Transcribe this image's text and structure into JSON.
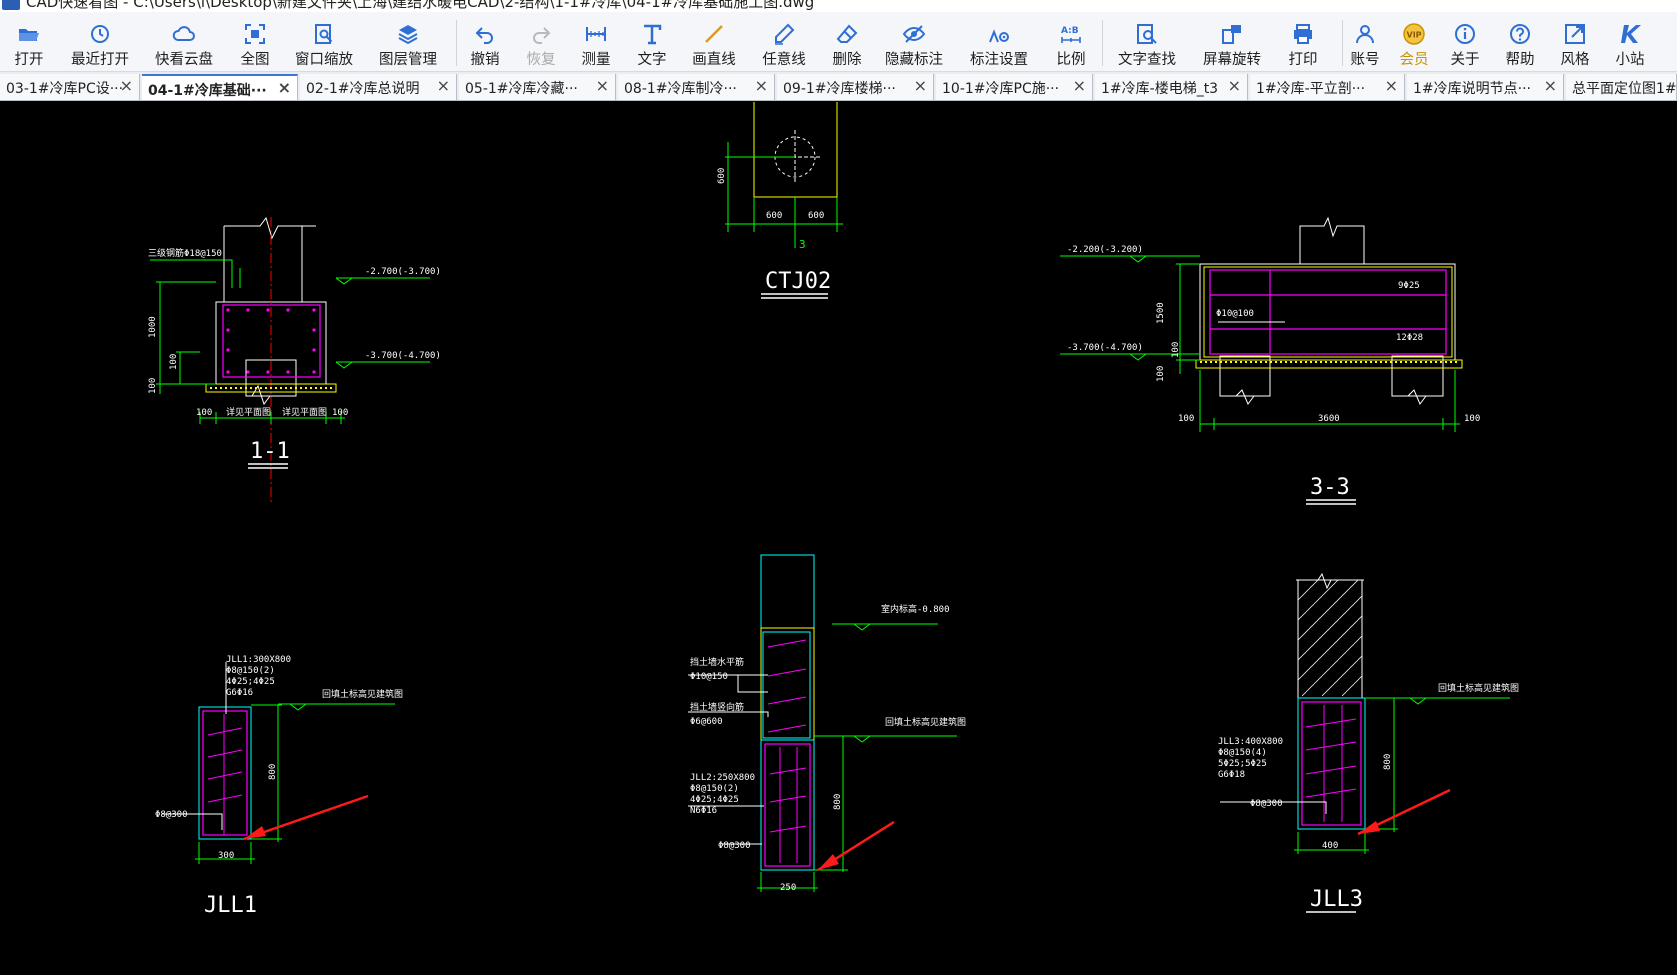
{
  "window": {
    "title": "CAD快速看图 - C:\\Users\\l\\Desktop\\新建文件夹\\上海\\建结水暖电CAD\\2-结构\\1-1#冷库\\04-1#冷库基础施工图.dwg"
  },
  "toolbar": {
    "items": [
      {
        "label": "打开",
        "icon": "folder-open-icon"
      },
      {
        "label": "最近打开",
        "icon": "history-clock-icon"
      },
      {
        "label": "快看云盘",
        "icon": "cloud-icon"
      },
      {
        "label": "全图",
        "icon": "fit-all-icon"
      },
      {
        "label": "窗口缩放",
        "icon": "window-zoom-icon"
      },
      {
        "label": "图层管理",
        "icon": "layers-icon"
      },
      {
        "label": "撤销",
        "icon": "undo-icon"
      },
      {
        "label": "恢复",
        "icon": "redo-icon"
      },
      {
        "label": "测量",
        "icon": "measure-ruler-icon"
      },
      {
        "label": "文字",
        "icon": "text-t-icon"
      },
      {
        "label": "画直线",
        "icon": "line-icon"
      },
      {
        "label": "任意线",
        "icon": "pen-icon"
      },
      {
        "label": "删除",
        "icon": "eraser-icon"
      },
      {
        "label": "隐藏标注",
        "icon": "eye-hide-icon"
      },
      {
        "label": "标注设置",
        "icon": "annotation-settings-icon"
      },
      {
        "label": "比例",
        "icon": "scale-ab-icon"
      },
      {
        "label": "文字查找",
        "icon": "text-search-icon"
      },
      {
        "label": "屏幕旋转",
        "icon": "screen-rotate-icon"
      },
      {
        "label": "打印",
        "icon": "printer-icon"
      },
      {
        "label": "账号",
        "icon": "user-icon"
      },
      {
        "label": "会员",
        "icon": "vip-badge-icon"
      },
      {
        "label": "关于",
        "icon": "info-icon"
      },
      {
        "label": "帮助",
        "icon": "help-icon"
      },
      {
        "label": "风格",
        "icon": "style-icon"
      },
      {
        "label": "小站",
        "icon": "site-k-icon"
      }
    ]
  },
  "tabs": [
    {
      "label": "03-1#冷库PC设···",
      "active": false
    },
    {
      "label": "04-1#冷库基础···",
      "active": true
    },
    {
      "label": "02-1#冷库总说明",
      "active": false
    },
    {
      "label": "05-1#冷库冷藏···",
      "active": false
    },
    {
      "label": "08-1#冷库制冷···",
      "active": false
    },
    {
      "label": "09-1#冷库楼梯···",
      "active": false
    },
    {
      "label": "10-1#冷库PC施···",
      "active": false
    },
    {
      "label": "1#冷库-楼电梯_t3",
      "active": false
    },
    {
      "label": "1#冷库-平立剖···",
      "active": false
    },
    {
      "label": "1#冷库说明节点···",
      "active": false
    },
    {
      "label": "总平面定位图1#",
      "active": false
    }
  ],
  "tab_close": "×",
  "drawing": {
    "titles": {
      "s11": "1-1",
      "ctj02": "CTJ02",
      "s33": "3-3",
      "jll1": "JLL1",
      "jll3": "JLL3"
    },
    "s11": {
      "note": "三级钢筋Φ18@150",
      "elev_top": "-2.700(-3.700)",
      "elev_bot": "-3.700(-4.700)",
      "dim_height": "1000",
      "dim_100a": "100",
      "dim_100b": "100",
      "dim_left": "100",
      "dim_w1": "详见平面图",
      "dim_w2": "详见平面图",
      "dim_right": "100"
    },
    "ctj02": {
      "dim_600v": "600",
      "dim_600a": "600",
      "dim_600b": "600",
      "marker": "3"
    },
    "s33": {
      "elev_top": "-2.200(-3.200)",
      "elev_bot": "-3.700(-4.700)",
      "dim_h": "1500",
      "dim_100v": "100",
      "dim_100": "100",
      "rebar_top": "9Φ25",
      "rebar_mid": "Φ10@100",
      "rebar_bot": "12Φ28",
      "dim_left": "100",
      "dim_span": "3600",
      "dim_right": "100"
    },
    "jll1": {
      "spec1": "JLL1:300X800",
      "spec2": "Φ8@150(2)",
      "spec3": "4Φ25;4Φ25",
      "spec4": "G6Φ16",
      "note": "回填土标高见建筑图",
      "dim_h": "800",
      "stirrup": "Φ8@300",
      "width": "300"
    },
    "jll2": {
      "elev": "室内标高-0.800",
      "wall1": "挡土墙水平筋",
      "wall1b": "Φ10@150",
      "wall2": "挡土墙竖向筋",
      "wall2b": "Φ6@600",
      "note": "回填土标高见建筑图",
      "spec1": "JLL2:250X800",
      "spec2": "Φ8@150(2)",
      "spec3": "4Φ25;4Φ25",
      "spec4": "N6Φ16",
      "dim_h": "800",
      "stirrup": "Φ8@300",
      "width": "250"
    },
    "jll3": {
      "note": "回填土标高见建筑图",
      "spec1": "JLL3:400X800",
      "spec2": "Φ8@150(4)",
      "spec3": "5Φ25;5Φ25",
      "spec4": "G6Φ18",
      "dim_h": "800",
      "stirrup": "Φ8@300",
      "width": "400"
    }
  },
  "colors": {
    "canvas": "#000000",
    "cad_white": "#ffffff",
    "cad_green": "#00ff00",
    "cad_yellow": "#ffff00",
    "cad_magenta": "#ff00ff",
    "cad_cyan": "#00ffff",
    "cad_red": "#ff0000",
    "arrow_red": "#ff1a1a",
    "toolbar_icon": "#2f6fd4",
    "vip_gold": "#c89400"
  }
}
